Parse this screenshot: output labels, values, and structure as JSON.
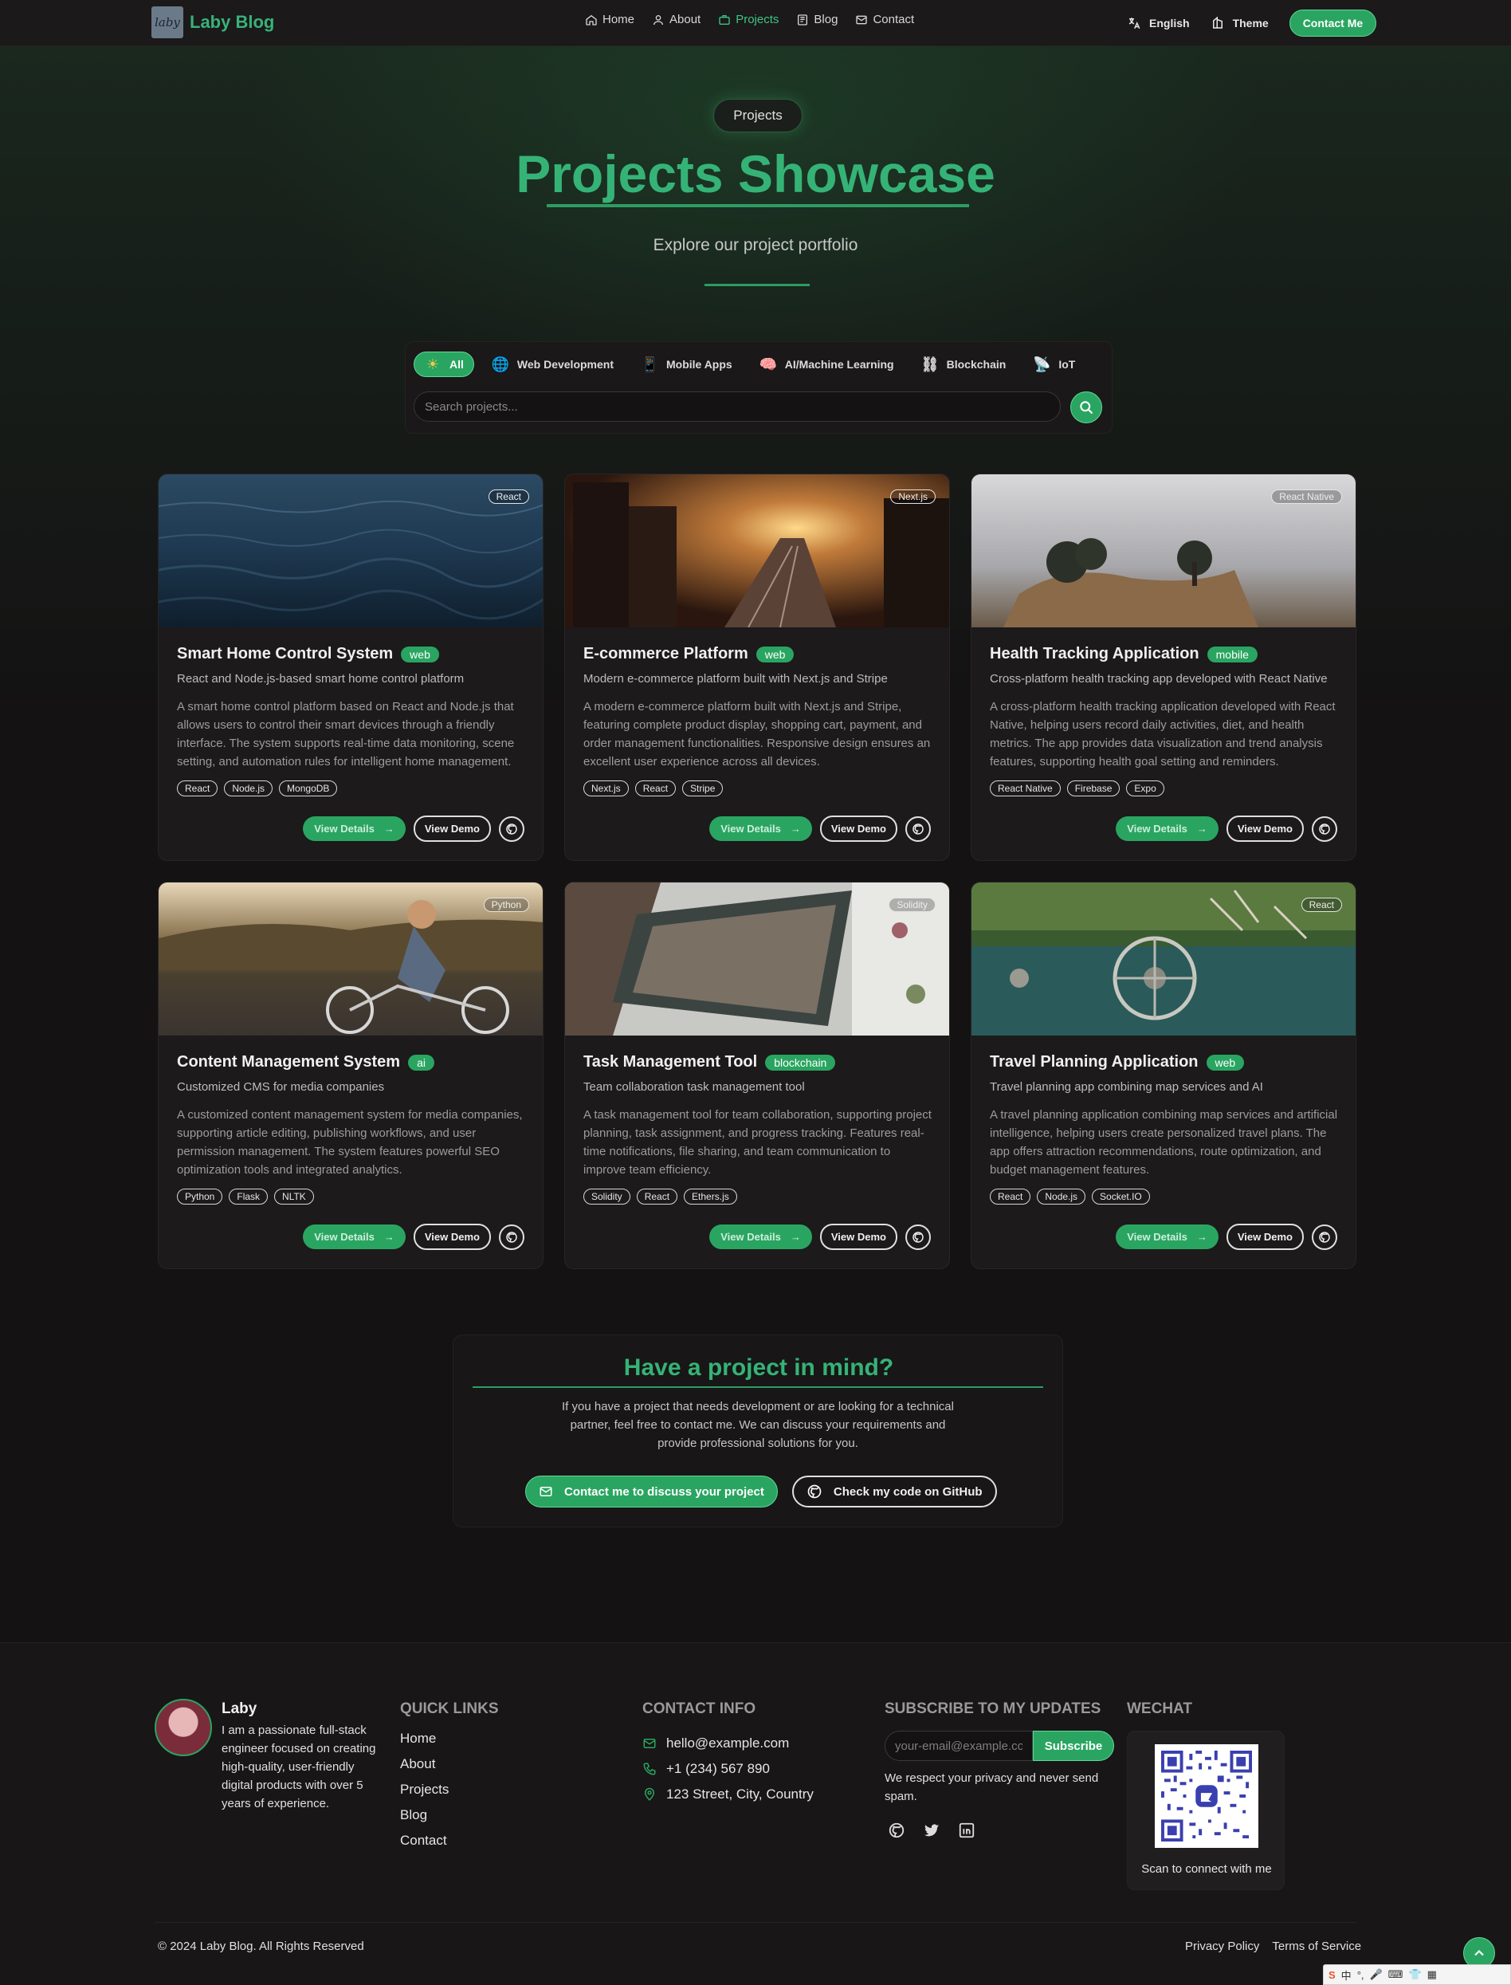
{
  "nav": {
    "logo_mark": "laby",
    "brand": "Laby Blog",
    "links": [
      {
        "label": "Home",
        "icon": "home-icon"
      },
      {
        "label": "About",
        "icon": "user-icon"
      },
      {
        "label": "Projects",
        "icon": "briefcase-icon",
        "active": true
      },
      {
        "label": "Blog",
        "icon": "book-icon"
      },
      {
        "label": "Contact",
        "icon": "mail-icon"
      }
    ],
    "language": "English",
    "theme": "Theme",
    "contact_button": "Contact Me"
  },
  "hero": {
    "pill": "Projects",
    "title": "Projects Showcase",
    "subtitle": "Explore our project portfolio"
  },
  "filters": {
    "items": [
      {
        "label": "All",
        "icon": "☀",
        "active": true
      },
      {
        "label": "Web Development",
        "icon": "🌐"
      },
      {
        "label": "Mobile Apps",
        "icon": "📱"
      },
      {
        "label": "AI/Machine Learning",
        "icon": "🧠"
      },
      {
        "label": "Blockchain",
        "icon": "⛓"
      },
      {
        "label": "IoT",
        "icon": "📡"
      }
    ],
    "search_placeholder": "Search projects..."
  },
  "card_buttons": {
    "details": "View Details",
    "demo": "View Demo"
  },
  "projects": [
    {
      "title": "Smart Home Control System",
      "category": "web",
      "tech": "React",
      "subtitle": "React and Node.js-based smart home control platform",
      "description": "A smart home control platform based on React and Node.js that allows users to control their smart devices through a friendly interface. The system supports real-time data monitoring, scene setting, and automation rules for intelligent home management.",
      "tags": [
        "React",
        "Node.js",
        "MongoDB"
      ]
    },
    {
      "title": "E-commerce Platform",
      "category": "web",
      "tech": "Next.js",
      "subtitle": "Modern e-commerce platform built with Next.js and Stripe",
      "description": "A modern e-commerce platform built with Next.js and Stripe, featuring complete product display, shopping cart, payment, and order management functionalities. Responsive design ensures an excellent user experience across all devices.",
      "tags": [
        "Next.js",
        "React",
        "Stripe"
      ]
    },
    {
      "title": "Health Tracking Application",
      "category": "mobile",
      "tech": "React Native",
      "subtitle": "Cross-platform health tracking app developed with React Native",
      "description": "A cross-platform health tracking application developed with React Native, helping users record daily activities, diet, and health metrics. The app provides data visualization and trend analysis features, supporting health goal setting and reminders.",
      "tags": [
        "React Native",
        "Firebase",
        "Expo"
      ]
    },
    {
      "title": "Content Management System",
      "category": "ai",
      "tech": "Python",
      "subtitle": "Customized CMS for media companies",
      "description": "A customized content management system for media companies, supporting article editing, publishing workflows, and user permission management. The system features powerful SEO optimization tools and integrated analytics.",
      "tags": [
        "Python",
        "Flask",
        "NLTK"
      ]
    },
    {
      "title": "Task Management Tool",
      "category": "blockchain",
      "tech": "Solidity",
      "subtitle": "Team collaboration task management tool",
      "description": "A task management tool for team collaboration, supporting project planning, task assignment, and progress tracking. Features real-time notifications, file sharing, and team communication to improve team efficiency.",
      "tags": [
        "Solidity",
        "React",
        "Ethers.js"
      ]
    },
    {
      "title": "Travel Planning Application",
      "category": "web",
      "tech": "React",
      "subtitle": "Travel planning app combining map services and AI",
      "description": "A travel planning application combining map services and artificial intelligence, helping users create personalized travel plans. The app offers attraction recommendations, route optimization, and budget management features.",
      "tags": [
        "React",
        "Node.js",
        "Socket.IO"
      ]
    }
  ],
  "cta": {
    "title": "Have a project in mind?",
    "text": "If you have a project that needs development or are looking for a technical partner, feel free to contact me. We can discuss your requirements and provide professional solutions for you.",
    "primary": "Contact me to discuss your project",
    "secondary": "Check my code on GitHub"
  },
  "footer": {
    "name": "Laby",
    "bio": "I am a passionate full-stack engineer focused on creating high-quality, user-friendly digital products with over 5 years of experience.",
    "quick_links_title": "QUICK LINKS",
    "quick_links": [
      "Home",
      "About",
      "Projects",
      "Blog",
      "Contact"
    ],
    "contact_title": "CONTACT INFO",
    "email": "hello@example.com",
    "phone": "+1 (234) 567 890",
    "address": "123 Street, City, Country",
    "subscribe_title": "SUBSCRIBE TO MY UPDATES",
    "subscribe_placeholder": "your-email@example.com",
    "subscribe_button": "Subscribe",
    "subscribe_note": "We respect your privacy and never send spam.",
    "wechat_title": "WECHAT",
    "wechat_caption": "Scan to connect with me",
    "copyright": "© 2024 Laby Blog. All Rights Reserved",
    "privacy": "Privacy Policy",
    "terms": "Terms of Service"
  },
  "ime": {
    "label": "中"
  },
  "colors": {
    "accent": "#2aa561",
    "title_green": "#35b377",
    "background": "#141213"
  }
}
